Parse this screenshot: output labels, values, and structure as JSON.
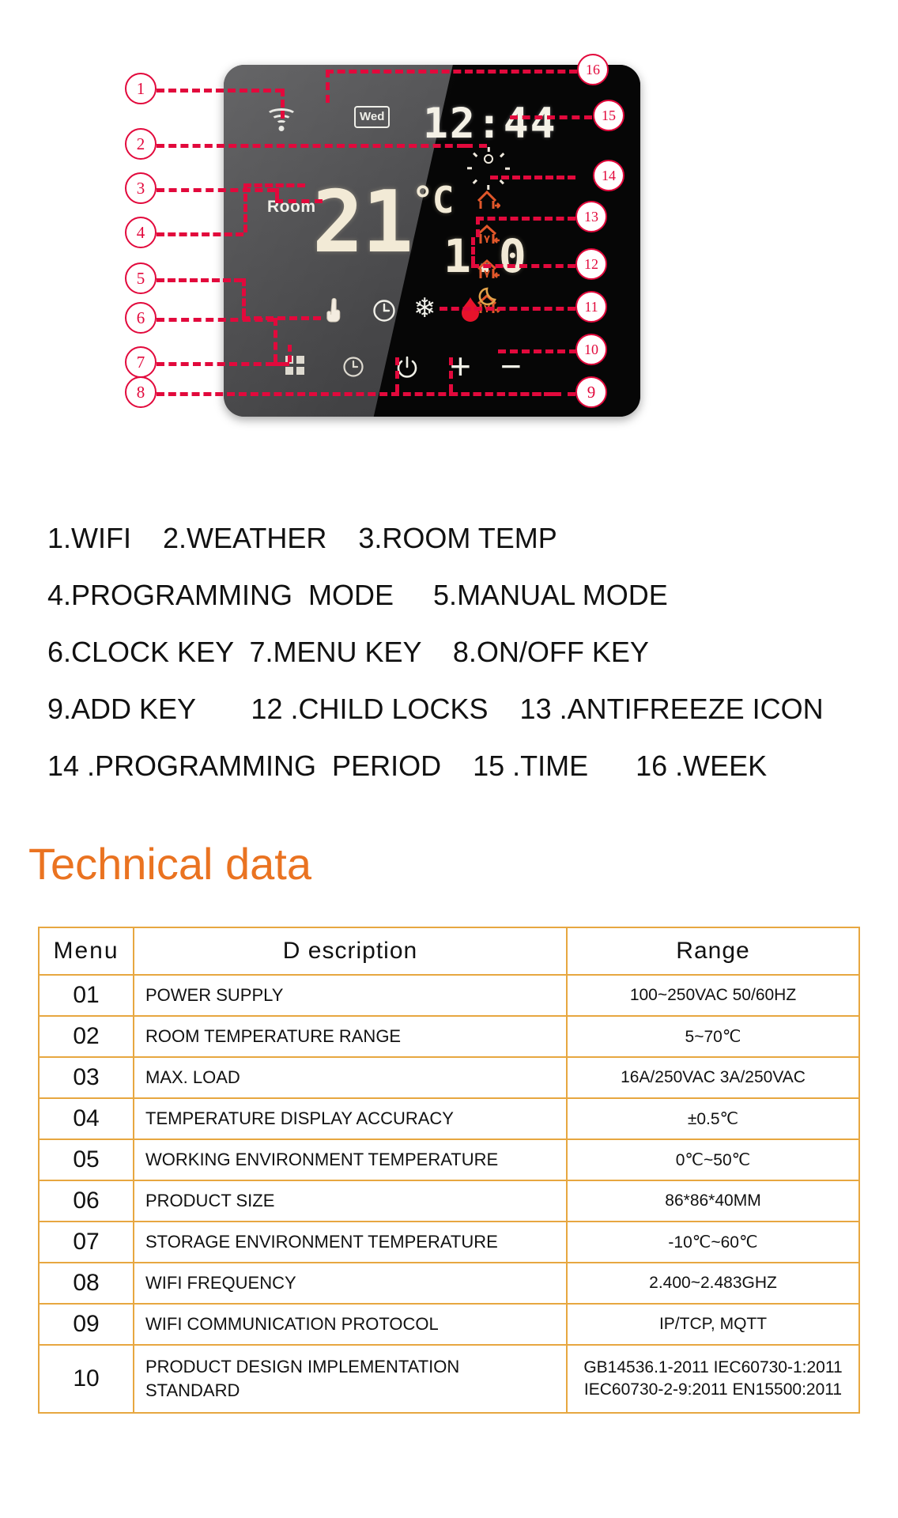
{
  "device": {
    "week_badge": "Wed",
    "time": "12:44",
    "room_label": "Room",
    "current_temp": "21",
    "current_unit": "°C",
    "set_temp": "1.0",
    "icons": {
      "wifi": "wifi-icon",
      "weather_sun": "sun-icon",
      "house_out": "house-leave-icon",
      "house_in": "house-return-icon",
      "house_in2": "house-return-icon",
      "house_out2": "house-leave-icon",
      "moon": "moon-icon",
      "hand": "hand-manual-icon",
      "clock": "clock-icon",
      "snowflake": "snowflake-icon",
      "flame": "flame-icon",
      "menu_grid": "grid-menu-icon",
      "clock_key": "clock-key-icon",
      "power": "power-icon",
      "plus": "+",
      "minus": "−"
    },
    "callouts": [
      "1",
      "2",
      "3",
      "4",
      "5",
      "6",
      "7",
      "8",
      "9",
      "10",
      "11",
      "12",
      "13",
      "14",
      "15",
      "16"
    ]
  },
  "legend": {
    "lines": [
      "1.WIFI    2.WEATHER    3.ROOM TEMP",
      "4.PROGRAMMING  MODE     5.MANUAL MODE",
      "6.CLOCK KEY  7.MENU KEY    8.ON/OFF KEY",
      "9.ADD KEY       12 .CHILD LOCKS    13 .ANTIFREEZE ICON",
      "14 .PROGRAMMING  PERIOD    15 .TIME      16 .WEEK"
    ]
  },
  "technical": {
    "title": "Technical data",
    "accent_color": "#ea7321",
    "border_color": "#e7a740",
    "headers": [
      "Menu",
      "D escription",
      "Range"
    ],
    "rows": [
      {
        "menu": "01",
        "description": "POWER SUPPLY",
        "range": "100~250VAC 50/60HZ"
      },
      {
        "menu": "02",
        "description": "ROOM TEMPERATURE RANGE",
        "range": "5~70℃"
      },
      {
        "menu": "03",
        "description": "MAX. LOAD",
        "range": "16A/250VAC 3A/250VAC"
      },
      {
        "menu": "04",
        "description": "TEMPERATURE DISPLAY ACCURACY",
        "range": "±0.5℃"
      },
      {
        "menu": "05",
        "description": "WORKING ENVIRONMENT TEMPERATURE",
        "range": "0℃~50℃"
      },
      {
        "menu": "06",
        "description": "PRODUCT SIZE",
        "range": "86*86*40MM"
      },
      {
        "menu": "07",
        "description": "STORAGE ENVIRONMENT TEMPERATURE",
        "range": "-10℃~60℃"
      },
      {
        "menu": "08",
        "description": "WIFI FREQUENCY",
        "range": "2.400~2.483GHZ"
      },
      {
        "menu": "09",
        "description": "WIFI COMMUNICATION PROTOCOL",
        "range": "IP/TCP, MQTT"
      },
      {
        "menu": "10",
        "description": "PRODUCT DESIGN IMPLEMENTATION\nSTANDARD",
        "range": "GB14536.1-2011 IEC60730-1:2011\nIEC60730-2-9:2011 EN15500:2011"
      }
    ]
  }
}
